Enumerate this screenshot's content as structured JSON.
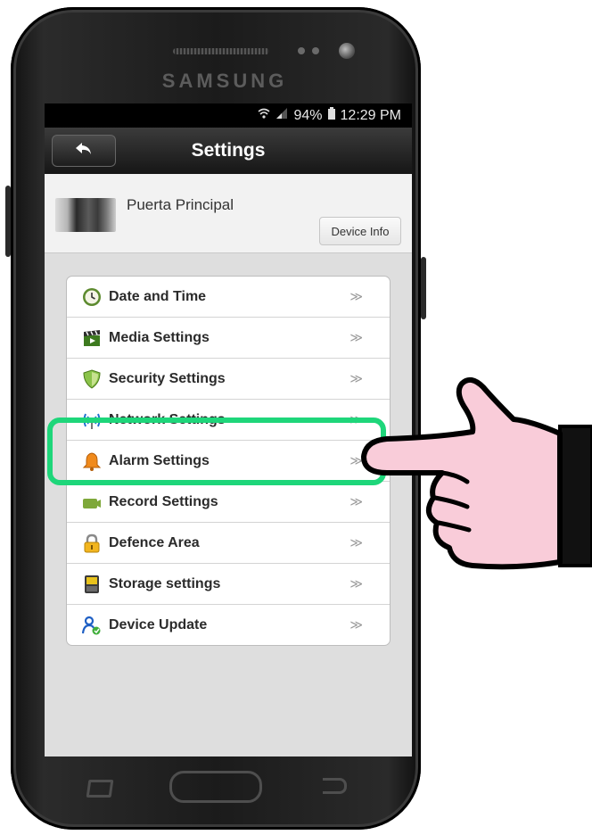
{
  "device": {
    "brand": "SAMSUNG"
  },
  "status_bar": {
    "battery": "94%",
    "time": "12:29 PM"
  },
  "header": {
    "title": "Settings",
    "back_icon": "back-arrow-icon"
  },
  "camera": {
    "name": "Puerta Principal",
    "info_button": "Device Info"
  },
  "menu": {
    "items": [
      {
        "label": "Date and Time",
        "icon": "clock-icon",
        "chevron": "≫"
      },
      {
        "label": "Media Settings",
        "icon": "clapper-icon",
        "chevron": "≫"
      },
      {
        "label": "Security Settings",
        "icon": "shield-icon",
        "chevron": "≫"
      },
      {
        "label": "Network Settings",
        "icon": "wifi-icon",
        "chevron": "≫"
      },
      {
        "label": "Alarm Settings",
        "icon": "bell-icon",
        "chevron": "≫"
      },
      {
        "label": "Record Settings",
        "icon": "record-icon",
        "chevron": "≫"
      },
      {
        "label": "Defence Area",
        "icon": "lock-icon",
        "chevron": "≫"
      },
      {
        "label": "Storage settings",
        "icon": "sdcard-icon",
        "chevron": "≫"
      },
      {
        "label": "Device Update",
        "icon": "update-icon",
        "chevron": "≫"
      }
    ]
  },
  "overlay": {
    "highlighted_item": "Alarm Settings",
    "highlight_color": "#1ed67a",
    "hand_color": "#f9ccd9"
  }
}
